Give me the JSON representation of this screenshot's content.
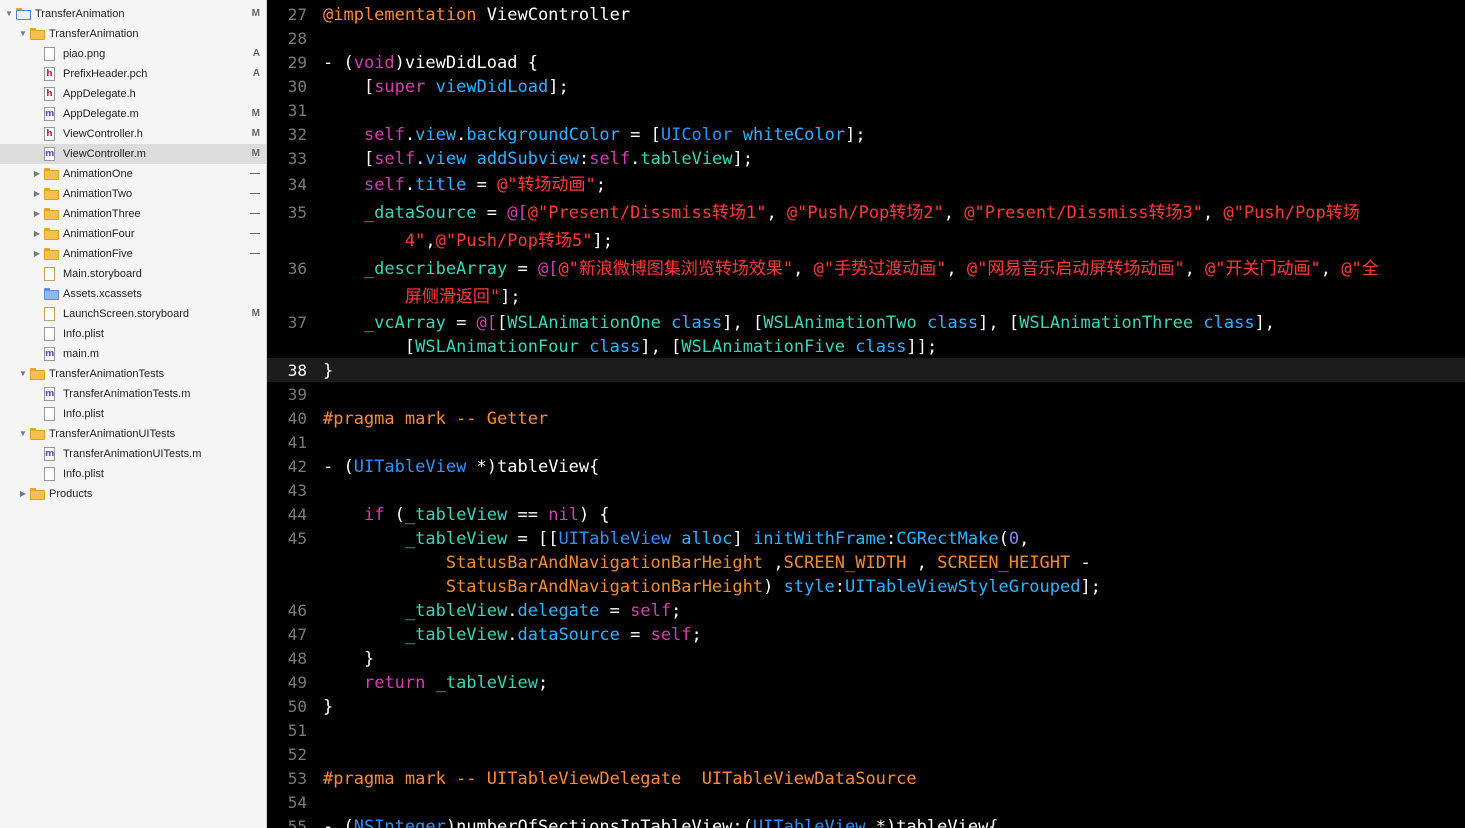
{
  "navigator": {
    "items": [
      {
        "label": "TransferAnimation",
        "type": "project",
        "indent": 0,
        "disclosure": "open",
        "status": "M",
        "selected": false
      },
      {
        "label": "TransferAnimation",
        "type": "folder",
        "indent": 1,
        "disclosure": "open",
        "status": "",
        "selected": false
      },
      {
        "label": "piao.png",
        "type": "plain",
        "indent": 2,
        "disclosure": "",
        "status": "A",
        "selected": false
      },
      {
        "label": "PrefixHeader.pch",
        "type": "h",
        "indent": 2,
        "disclosure": "",
        "status": "A",
        "selected": false
      },
      {
        "label": "AppDelegate.h",
        "type": "h",
        "indent": 2,
        "disclosure": "",
        "status": "",
        "selected": false
      },
      {
        "label": "AppDelegate.m",
        "type": "m",
        "indent": 2,
        "disclosure": "",
        "status": "M",
        "selected": false
      },
      {
        "label": "ViewController.h",
        "type": "h",
        "indent": 2,
        "disclosure": "",
        "status": "M",
        "selected": false
      },
      {
        "label": "ViewController.m",
        "type": "m",
        "indent": 2,
        "disclosure": "",
        "status": "M",
        "selected": true
      },
      {
        "label": "AnimationOne",
        "type": "folder",
        "indent": 2,
        "disclosure": "closed",
        "status": "—",
        "selected": false
      },
      {
        "label": "AnimationTwo",
        "type": "folder",
        "indent": 2,
        "disclosure": "closed",
        "status": "—",
        "selected": false
      },
      {
        "label": "AnimationThree",
        "type": "folder",
        "indent": 2,
        "disclosure": "closed",
        "status": "—",
        "selected": false
      },
      {
        "label": "AnimationFour",
        "type": "folder",
        "indent": 2,
        "disclosure": "closed",
        "status": "—",
        "selected": false
      },
      {
        "label": "AnimationFive",
        "type": "folder",
        "indent": 2,
        "disclosure": "closed",
        "status": "—",
        "selected": false
      },
      {
        "label": "Main.storyboard",
        "type": "storyboard",
        "indent": 2,
        "disclosure": "",
        "status": "",
        "selected": false
      },
      {
        "label": "Assets.xcassets",
        "type": "assets",
        "indent": 2,
        "disclosure": "",
        "status": "",
        "selected": false
      },
      {
        "label": "LaunchScreen.storyboard",
        "type": "storyboard",
        "indent": 2,
        "disclosure": "",
        "status": "M",
        "selected": false
      },
      {
        "label": "Info.plist",
        "type": "plain",
        "indent": 2,
        "disclosure": "",
        "status": "",
        "selected": false
      },
      {
        "label": "main.m",
        "type": "m",
        "indent": 2,
        "disclosure": "",
        "status": "",
        "selected": false
      },
      {
        "label": "TransferAnimationTests",
        "type": "folder",
        "indent": 1,
        "disclosure": "open",
        "status": "",
        "selected": false
      },
      {
        "label": "TransferAnimationTests.m",
        "type": "m",
        "indent": 2,
        "disclosure": "",
        "status": "",
        "selected": false
      },
      {
        "label": "Info.plist",
        "type": "plain",
        "indent": 2,
        "disclosure": "",
        "status": "",
        "selected": false
      },
      {
        "label": "TransferAnimationUITests",
        "type": "folder",
        "indent": 1,
        "disclosure": "open",
        "status": "",
        "selected": false
      },
      {
        "label": "TransferAnimationUITests.m",
        "type": "m",
        "indent": 2,
        "disclosure": "",
        "status": "",
        "selected": false
      },
      {
        "label": "Info.plist",
        "type": "plain",
        "indent": 2,
        "disclosure": "",
        "status": "",
        "selected": false
      },
      {
        "label": "Products",
        "type": "folder",
        "indent": 1,
        "disclosure": "closed",
        "status": "",
        "selected": false
      }
    ]
  },
  "editor": {
    "current_line": "38",
    "lines": [
      {
        "num": "27",
        "code": [
          [
            "@implementation",
            "dir"
          ],
          [
            " ViewController",
            ""
          ]
        ]
      },
      {
        "num": "28",
        "code": []
      },
      {
        "num": "29",
        "code": [
          [
            "- (",
            ""
          ],
          [
            "void",
            "kw"
          ],
          [
            ")viewDidLoad {",
            ""
          ]
        ]
      },
      {
        "num": "30",
        "code": [
          [
            "    [",
            ""
          ],
          [
            "super",
            "kw"
          ],
          [
            " ",
            ""
          ],
          [
            "viewDidLoad",
            "mth"
          ],
          [
            "];",
            ""
          ]
        ]
      },
      {
        "num": "31",
        "code": []
      },
      {
        "num": "32",
        "code": [
          [
            "    ",
            ""
          ],
          [
            "self",
            "kw"
          ],
          [
            ".",
            ""
          ],
          [
            "view",
            "mth"
          ],
          [
            ".",
            ""
          ],
          [
            "backgroundColor",
            "mth"
          ],
          [
            " = [",
            ""
          ],
          [
            "UIColor",
            "cls"
          ],
          [
            " ",
            ""
          ],
          [
            "whiteColor",
            "mth"
          ],
          [
            "];",
            ""
          ]
        ]
      },
      {
        "num": "33",
        "code": [
          [
            "    [",
            ""
          ],
          [
            "self",
            "kw"
          ],
          [
            ".",
            ""
          ],
          [
            "view",
            "mth"
          ],
          [
            " ",
            ""
          ],
          [
            "addSubview",
            "mth"
          ],
          [
            ":",
            ""
          ],
          [
            "self",
            "kw"
          ],
          [
            ".",
            ""
          ],
          [
            "tableView",
            "prj"
          ],
          [
            "];",
            ""
          ]
        ]
      },
      {
        "num": "34",
        "code": [
          [
            "    ",
            ""
          ],
          [
            "self",
            "kw"
          ],
          [
            ".",
            ""
          ],
          [
            "title",
            "mth"
          ],
          [
            " = ",
            ""
          ],
          [
            "@\"转场动画\"",
            "str"
          ],
          [
            ";",
            ""
          ]
        ]
      },
      {
        "num": "35",
        "code": [
          [
            "    _dataSource",
            "prj"
          ],
          [
            " = ",
            ""
          ],
          [
            "@[",
            "kw"
          ],
          [
            "@\"Present/Dissmiss转场1\"",
            "str"
          ],
          [
            ", ",
            ""
          ],
          [
            "@\"Push/Pop转场2\"",
            "str"
          ],
          [
            ", ",
            ""
          ],
          [
            "@\"Present/Dissmiss转场3\"",
            "str"
          ],
          [
            ", ",
            ""
          ],
          [
            "@\"Push/Pop转场",
            "str"
          ]
        ]
      },
      {
        "num": "",
        "code": [
          [
            "        ",
            ""
          ],
          [
            "4\"",
            "str"
          ],
          [
            ",",
            ""
          ],
          [
            "@\"Push/Pop转场5\"",
            "str"
          ],
          [
            "];",
            ""
          ]
        ]
      },
      {
        "num": "36",
        "code": [
          [
            "    _describeArray",
            "prj"
          ],
          [
            " = ",
            ""
          ],
          [
            "@[",
            "kw"
          ],
          [
            "@\"新浪微博图集浏览转场效果\"",
            "str"
          ],
          [
            ", ",
            ""
          ],
          [
            "@\"手势过渡动画\"",
            "str"
          ],
          [
            ", ",
            ""
          ],
          [
            "@\"网易音乐启动屏转场动画\"",
            "str"
          ],
          [
            ", ",
            ""
          ],
          [
            "@\"开关门动画\"",
            "str"
          ],
          [
            ", ",
            ""
          ],
          [
            "@\"全",
            "str"
          ]
        ]
      },
      {
        "num": "",
        "code": [
          [
            "        ",
            ""
          ],
          [
            "屏侧滑返回\"",
            "str"
          ],
          [
            "];",
            ""
          ]
        ]
      },
      {
        "num": "37",
        "code": [
          [
            "    _vcArray",
            "prj"
          ],
          [
            " = ",
            ""
          ],
          [
            "@[",
            "kw"
          ],
          [
            "[",
            ""
          ],
          [
            "WSLAnimationOne",
            "prj"
          ],
          [
            " ",
            ""
          ],
          [
            "class",
            "mth"
          ],
          [
            "], [",
            ""
          ],
          [
            "WSLAnimationTwo",
            "prj"
          ],
          [
            " ",
            ""
          ],
          [
            "class",
            "mth"
          ],
          [
            "], [",
            ""
          ],
          [
            "WSLAnimationThree",
            "prj"
          ],
          [
            " ",
            ""
          ],
          [
            "class",
            "mth"
          ],
          [
            "],",
            ""
          ]
        ]
      },
      {
        "num": "",
        "code": [
          [
            "        [",
            ""
          ],
          [
            "WSLAnimationFour",
            "prj"
          ],
          [
            " ",
            ""
          ],
          [
            "class",
            "mth"
          ],
          [
            "], [",
            ""
          ],
          [
            "WSLAnimationFive",
            "prj"
          ],
          [
            " ",
            ""
          ],
          [
            "class",
            "mth"
          ],
          [
            "]];",
            ""
          ]
        ]
      },
      {
        "num": "38",
        "code": [
          [
            "}",
            ""
          ]
        ]
      },
      {
        "num": "39",
        "code": []
      },
      {
        "num": "40",
        "code": [
          [
            "#pragma mark -- Getter",
            "dir"
          ]
        ]
      },
      {
        "num": "41",
        "code": []
      },
      {
        "num": "42",
        "code": [
          [
            "- (",
            ""
          ],
          [
            "UITableView",
            "cls"
          ],
          [
            " *)tableView{",
            ""
          ]
        ]
      },
      {
        "num": "43",
        "code": []
      },
      {
        "num": "44",
        "code": [
          [
            "    ",
            ""
          ],
          [
            "if",
            "kw"
          ],
          [
            " (",
            ""
          ],
          [
            "_tableView",
            "prj"
          ],
          [
            " == ",
            ""
          ],
          [
            "nil",
            "kw"
          ],
          [
            ") {",
            ""
          ]
        ]
      },
      {
        "num": "45",
        "code": [
          [
            "        ",
            ""
          ],
          [
            "_tableView",
            "prj"
          ],
          [
            " = [[",
            ""
          ],
          [
            "UITableView",
            "cls"
          ],
          [
            " ",
            ""
          ],
          [
            "alloc",
            "mth"
          ],
          [
            "] ",
            ""
          ],
          [
            "initWithFrame",
            "mth"
          ],
          [
            ":",
            ""
          ],
          [
            "CGRectMake",
            "mth"
          ],
          [
            "(",
            ""
          ],
          [
            "0",
            "num"
          ],
          [
            ",",
            ""
          ]
        ]
      },
      {
        "num": "",
        "code": [
          [
            "            ",
            ""
          ],
          [
            "StatusBarAndNavigationBarHeight",
            "mac"
          ],
          [
            " ,",
            ""
          ],
          [
            "SCREEN_WIDTH",
            "mac"
          ],
          [
            " , ",
            ""
          ],
          [
            "SCREEN_HEIGHT",
            "mac"
          ],
          [
            " -",
            ""
          ]
        ]
      },
      {
        "num": "",
        "code": [
          [
            "            ",
            ""
          ],
          [
            "StatusBarAndNavigationBarHeight",
            "mac"
          ],
          [
            ") ",
            ""
          ],
          [
            "style",
            "mth"
          ],
          [
            ":",
            ""
          ],
          [
            "UITableViewStyleGrouped",
            "mth"
          ],
          [
            "];",
            ""
          ]
        ]
      },
      {
        "num": "46",
        "code": [
          [
            "        ",
            ""
          ],
          [
            "_tableView",
            "prj"
          ],
          [
            ".",
            ""
          ],
          [
            "delegate",
            "mth"
          ],
          [
            " = ",
            ""
          ],
          [
            "self",
            "kw"
          ],
          [
            ";",
            ""
          ]
        ]
      },
      {
        "num": "47",
        "code": [
          [
            "        ",
            ""
          ],
          [
            "_tableView",
            "prj"
          ],
          [
            ".",
            ""
          ],
          [
            "dataSource",
            "mth"
          ],
          [
            " = ",
            ""
          ],
          [
            "self",
            "kw"
          ],
          [
            ";",
            ""
          ]
        ]
      },
      {
        "num": "48",
        "code": [
          [
            "    }",
            ""
          ]
        ]
      },
      {
        "num": "49",
        "code": [
          [
            "    ",
            ""
          ],
          [
            "return",
            "kw"
          ],
          [
            " ",
            ""
          ],
          [
            "_tableView",
            "prj"
          ],
          [
            ";",
            ""
          ]
        ]
      },
      {
        "num": "50",
        "code": [
          [
            "}",
            ""
          ]
        ]
      },
      {
        "num": "51",
        "code": []
      },
      {
        "num": "52",
        "code": []
      },
      {
        "num": "53",
        "code": [
          [
            "#pragma mark -- UITableViewDelegate  UITableViewDataSource",
            "dir"
          ]
        ]
      },
      {
        "num": "54",
        "code": []
      },
      {
        "num": "55",
        "code": [
          [
            "- (",
            ""
          ],
          [
            "NSInteger",
            "cls"
          ],
          [
            ")numberOfSectionsInTableView:(",
            ""
          ],
          [
            "UITableView",
            "cls"
          ],
          [
            " *)tableView{",
            ""
          ]
        ]
      }
    ]
  }
}
